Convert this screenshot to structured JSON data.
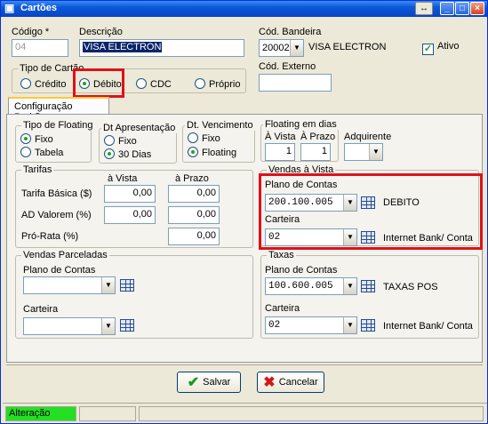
{
  "window": {
    "title": "Cartões",
    "buttons": {
      "special": "↔",
      "minimize": "_",
      "maximize": "□",
      "close": "×"
    }
  },
  "header": {
    "codigo_label": "Código *",
    "codigo_value": "04",
    "descricao_label": "Descrição",
    "descricao_value": "VISA ELECTRON",
    "cod_bandeira_label": "Cód. Bandeira",
    "cod_bandeira_value": "20002",
    "bandeira_name": "VISA ELECTRON",
    "ativo_label": "Ativo",
    "ativo_checked": true,
    "cod_externo_label": "Cód. Externo",
    "cod_externo_value": ""
  },
  "tipo_cartao": {
    "legend": "Tipo de Cartão",
    "options": [
      "Crédito",
      "Débito",
      "CDC",
      "Próprio"
    ],
    "selected": "Débito"
  },
  "tabs": [
    {
      "label": "Configuração Padrão"
    }
  ],
  "tipo_floating": {
    "legend": "Tipo de Floating",
    "options": [
      "Fixo",
      "Tabela"
    ],
    "selected": "Fixo"
  },
  "dt_apresentacao": {
    "legend": "Dt Apresentação",
    "options": [
      "Fixo",
      "30 Dias"
    ],
    "selected": "30 Dias"
  },
  "dt_vencimento": {
    "legend": "Dt. Vencimento",
    "options": [
      "Fixo",
      "Floating"
    ],
    "selected": "Floating"
  },
  "floating_dias": {
    "legend": "Floating em dias",
    "a_vista_label": "À Vista",
    "a_vista_value": "1",
    "a_prazo_label": "À Prazo",
    "a_prazo_value": "1",
    "adquirente_label": "Adquirente",
    "adquirente_value": ""
  },
  "tarifas": {
    "legend": "Tarifas",
    "col_vista": "à Vista",
    "col_prazo": "à Prazo",
    "rows": [
      {
        "label": "Tarifa Básica ($)",
        "vista": "0,00",
        "prazo": "0,00"
      },
      {
        "label": "AD Valorem (%)",
        "vista": "0,00",
        "prazo": "0,00"
      },
      {
        "label": "Pró-Rata (%)",
        "vista": "",
        "prazo": "0,00"
      }
    ]
  },
  "vendas_vista": {
    "legend": "Vendas à Vista",
    "plano_label": "Plano de Contas",
    "plano_value": "200.100.005",
    "plano_desc": "DEBITO",
    "carteira_label": "Carteira",
    "carteira_value": "02",
    "carteira_desc": "Internet Bank/ Conta"
  },
  "vendas_parceladas": {
    "legend": "Vendas Parceladas",
    "plano_label": "Plano de Contas",
    "plano_value": "",
    "carteira_label": "Carteira",
    "carteira_value": ""
  },
  "taxas": {
    "legend": "Taxas",
    "plano_label": "Plano de Contas",
    "plano_value": "100.600.005",
    "plano_desc": "TAXAS POS",
    "carteira_label": "Carteira",
    "carteira_value": "02",
    "carteira_desc": "Internet Bank/ Conta"
  },
  "actions": {
    "salvar": "Salvar",
    "cancelar": "Cancelar"
  },
  "status": {
    "mode": "Alteração",
    "mode_color": "#22e022"
  }
}
